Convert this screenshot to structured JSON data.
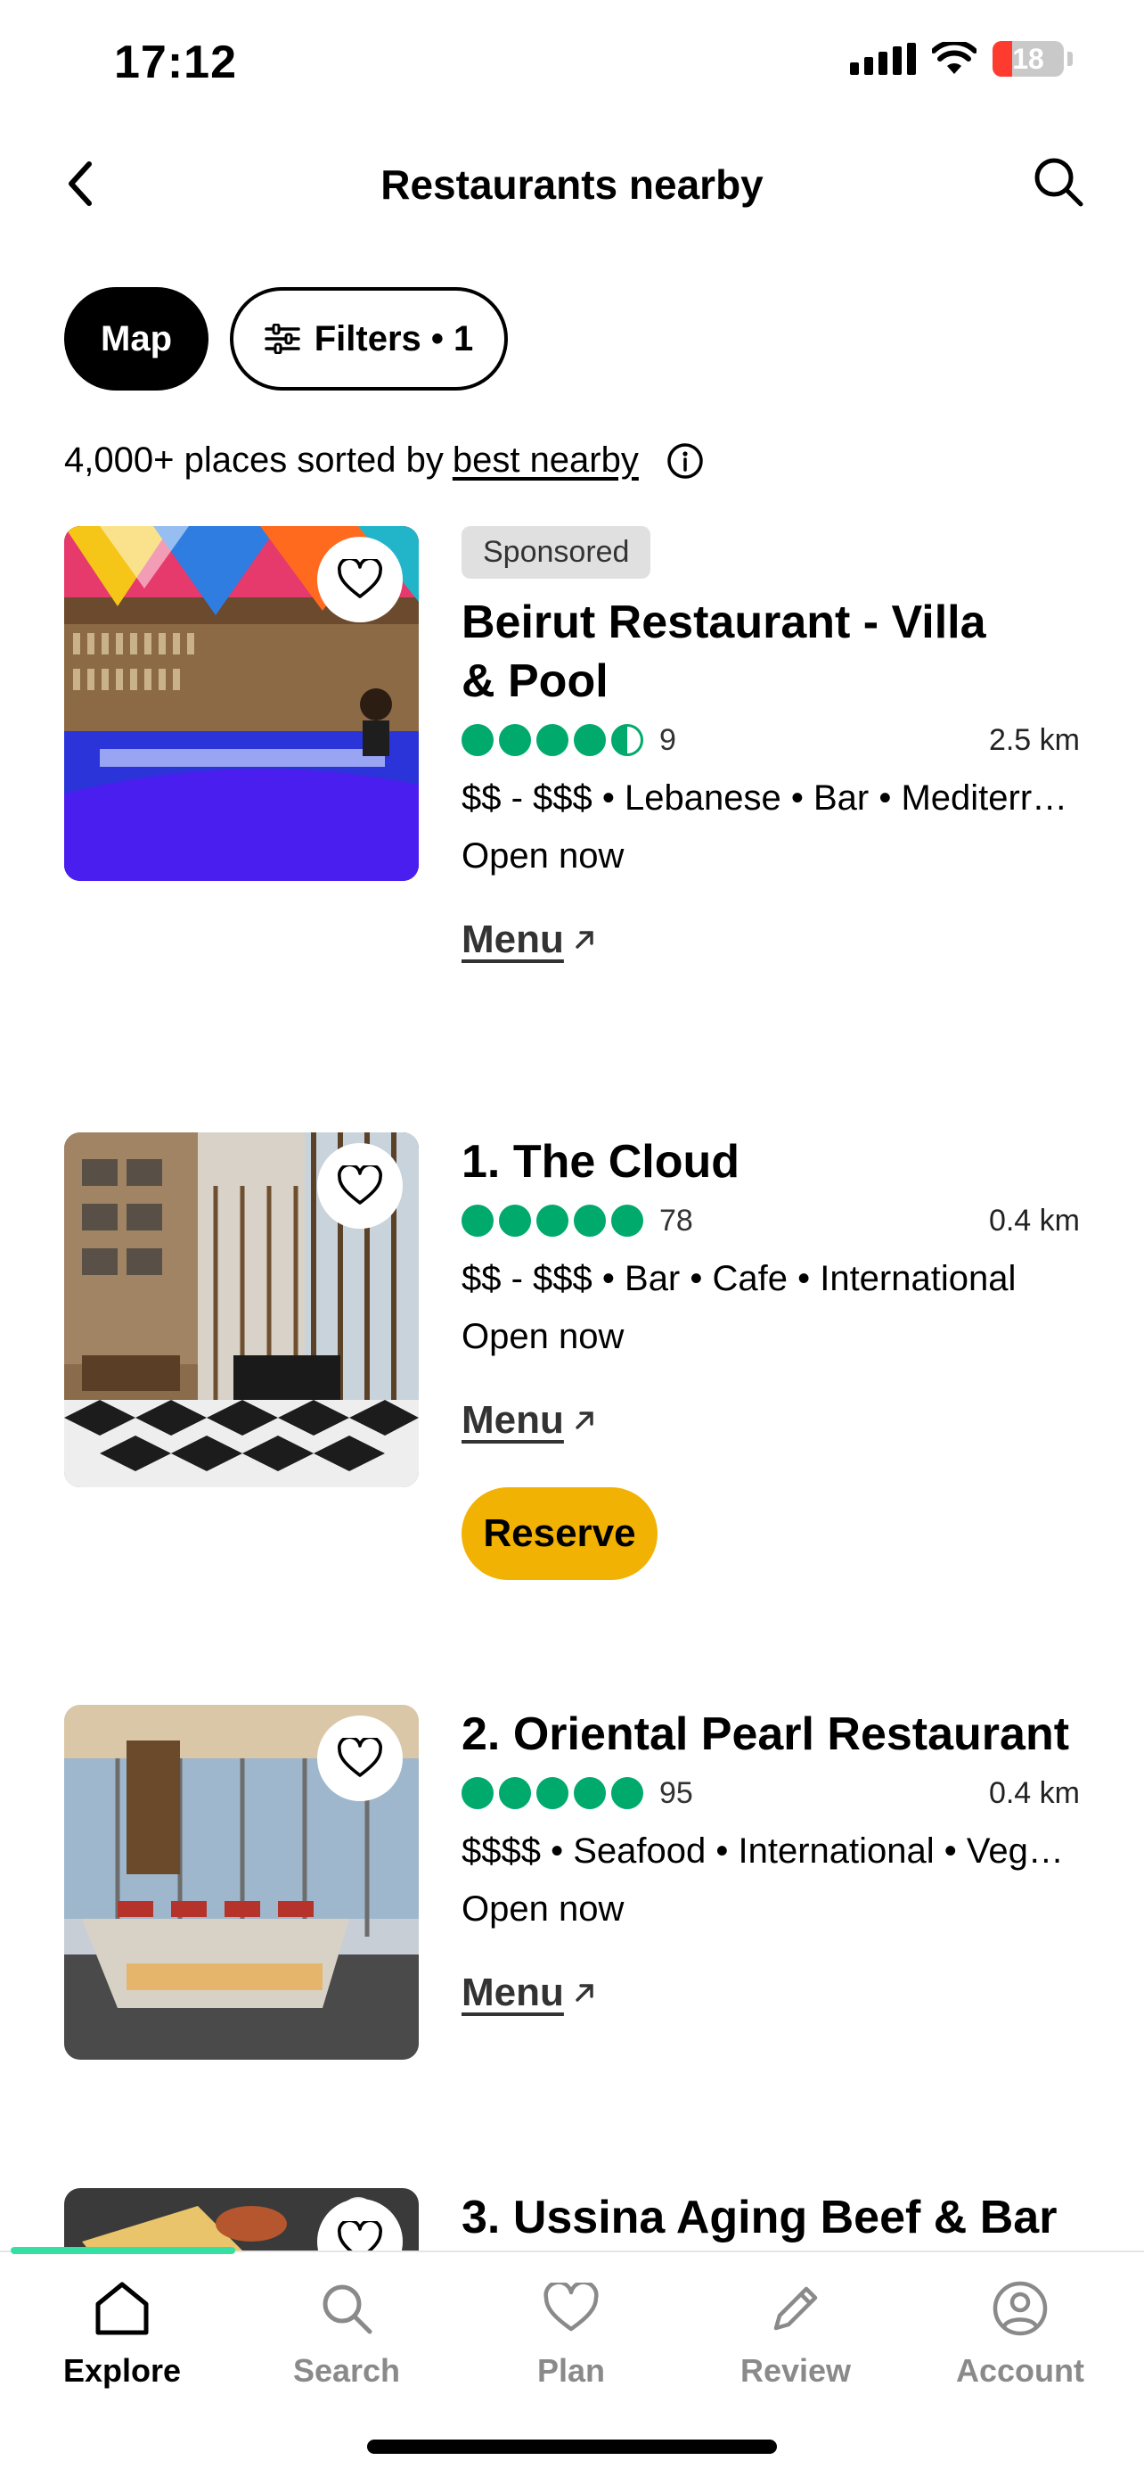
{
  "status_bar": {
    "time": "17:12",
    "battery": "18"
  },
  "header": {
    "title": "Restaurants nearby"
  },
  "chips": {
    "map": "Map",
    "filters": "Filters • 1"
  },
  "summary": {
    "prefix": "4,000+ places sorted by",
    "link": "best nearby"
  },
  "restaurants": [
    {
      "badge": "Sponsored",
      "name": "Beirut Restaurant - Villa & Pool",
      "rating": 4.5,
      "reviews": "9",
      "distance": "2.5 km",
      "tags": "$$ - $$$ • Lebanese • Bar • Mediterranean",
      "status": "Open now",
      "menu": "Menu"
    },
    {
      "name": "1. The Cloud",
      "rating": 5,
      "reviews": "78",
      "distance": "0.4 km",
      "tags": "$$ - $$$ • Bar • Cafe • International",
      "status": "Open now",
      "menu": "Menu",
      "reserve": "Reserve"
    },
    {
      "name": "2. Oriental Pearl Restaurant",
      "rating": 5,
      "reviews": "95",
      "distance": "0.4 km",
      "tags": "$$$$ • Seafood • International • Vegetarian",
      "status": "Open now",
      "menu": "Menu"
    },
    {
      "name": "3. Ussina Aging Beef & Bar"
    }
  ],
  "bottom_nav": [
    {
      "label": "Explore",
      "icon": "home-icon",
      "active": true
    },
    {
      "label": "Search",
      "icon": "search-icon"
    },
    {
      "label": "Plan",
      "icon": "heart-icon"
    },
    {
      "label": "Review",
      "icon": "pencil-icon"
    },
    {
      "label": "Account",
      "icon": "user-circle-icon"
    }
  ],
  "colors": {
    "rating_green": "#00aa6c",
    "reserve_yellow": "#f2b203",
    "nav_indicator": "#34e0a1"
  }
}
